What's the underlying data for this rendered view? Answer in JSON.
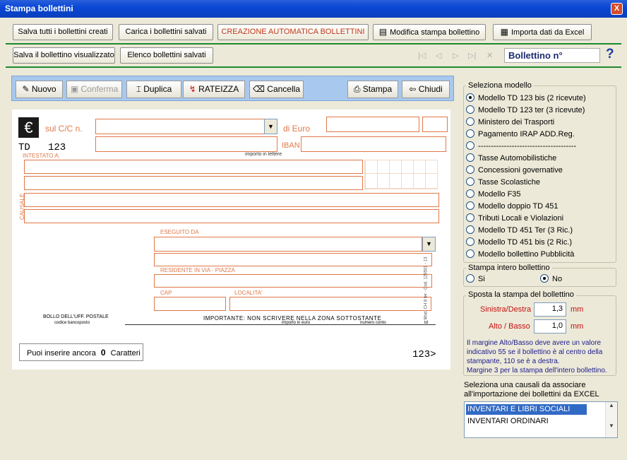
{
  "window": {
    "title": "Stampa bollettini",
    "close_label": "X"
  },
  "toolbar1": {
    "save_all": "Salva tutti i bollettini creati",
    "load_saved": "Carica i bollettini salvati",
    "auto_create": "CREAZIONE AUTOMATICA BOLLETTINI",
    "edit_print": "Modifica stampa bollettino",
    "import_excel": "Importa dati da Excel"
  },
  "toolbar2": {
    "save_shown": "Salva il bollettino visualizzato",
    "saved_list": "Elenco bollettini salvati"
  },
  "nav": {
    "first": "|◁",
    "prev": "◁",
    "next": "▷",
    "last": "▷|",
    "delete": "✕",
    "bollettino_label": "Bollettino n°",
    "help": "?"
  },
  "actions": {
    "nuovo": "Nuovo",
    "conferma": "Conferma",
    "duplica": "Duplica",
    "rateizza": "RATEIZZA",
    "cancella": "Cancella",
    "stampa": "Stampa",
    "chiudi": "Chiudi"
  },
  "form": {
    "euro_symbol": "€",
    "sul_cc": "sul C/C n.",
    "di_euro": "di Euro",
    "td": "TD   123",
    "iban": "IBAN",
    "importo_lettere": "importo in lettere",
    "intestato": "INTESTATO A:",
    "causale": "CAUSALE",
    "eseguito_da": "ESEGUITO DA",
    "residente": "RESIDENTE IN VIA - PIAZZA",
    "cap": "CAP",
    "localita": "LOCALITA'",
    "side_code": "Mod. CH 8 ter - Cod. 129501 - 13",
    "bollo": "BOLLO DELL'UFF. POSTALE",
    "codice_bancoposto": "codice bancoposto",
    "importante": "IMPORTANTE: NON SCRIVERE NELLA ZONA SOTTOSTANTE",
    "importo_euro": "importo in euro",
    "numero_conto": "numero conto",
    "td_small": "td",
    "counter_prefix": "Puoi inserire ancora",
    "counter_value": "0",
    "counter_suffix": "Caratteri",
    "code_123": "123>"
  },
  "modello": {
    "title": "Seleziona modello",
    "options": [
      "Modello TD 123 bis (2 ricevute)",
      "Modello TD 123 ter (3 ricevute)",
      "Ministero dei Trasporti",
      "Pagamento IRAP ADD.Reg.",
      "--------------------------------------",
      "Tasse Automobilistiche",
      "Concessioni governative",
      "Tasse Scolastiche",
      "Modello F35",
      "Modello doppio TD 451",
      "Tributi Locali e Violazioni",
      "Modello TD 451 Ter (3 Ric.)",
      "Modello TD 451 bis (2 Ric.)",
      "Modello bollettino Pubblicità"
    ],
    "selected": "Modello TD 123 bis (2 ricevute)"
  },
  "intero": {
    "title": "Stampa intero bollettino",
    "si": "Si",
    "no": "No",
    "selected": "No"
  },
  "sposta": {
    "title": "Sposta la stampa del bollettino",
    "sx_label": "Sinistra/Destra",
    "sx_value": "1,3",
    "sx_unit": "mm",
    "ab_label": "Alto / Basso",
    "ab_value": "1,0",
    "ab_unit": "mm",
    "note1": "Il margine Alto/Basso deve avere un valore",
    "note2": "indicativo 55 se il bollettino è al centro della",
    "note3": "stampante, 110 se è a destra.",
    "note4": "Margine 3 per la stampa dell'intero bollettino."
  },
  "causali": {
    "label1": "Seleziona una causali da associare",
    "label2": "all'importazione dei bollettini da EXCEL",
    "items": [
      "INVENTARI E LIBRI SOCIALI",
      "INVENTARI ORDINARI"
    ],
    "selected": "INVENTARI E LIBRI SOCIALI"
  },
  "colors": {
    "accent": "#e07848",
    "title_blue": "#0a48d6",
    "toolbar_blue": "#a8c8ee",
    "note_blue": "#1c1c8c",
    "label_red": "#c41010"
  }
}
